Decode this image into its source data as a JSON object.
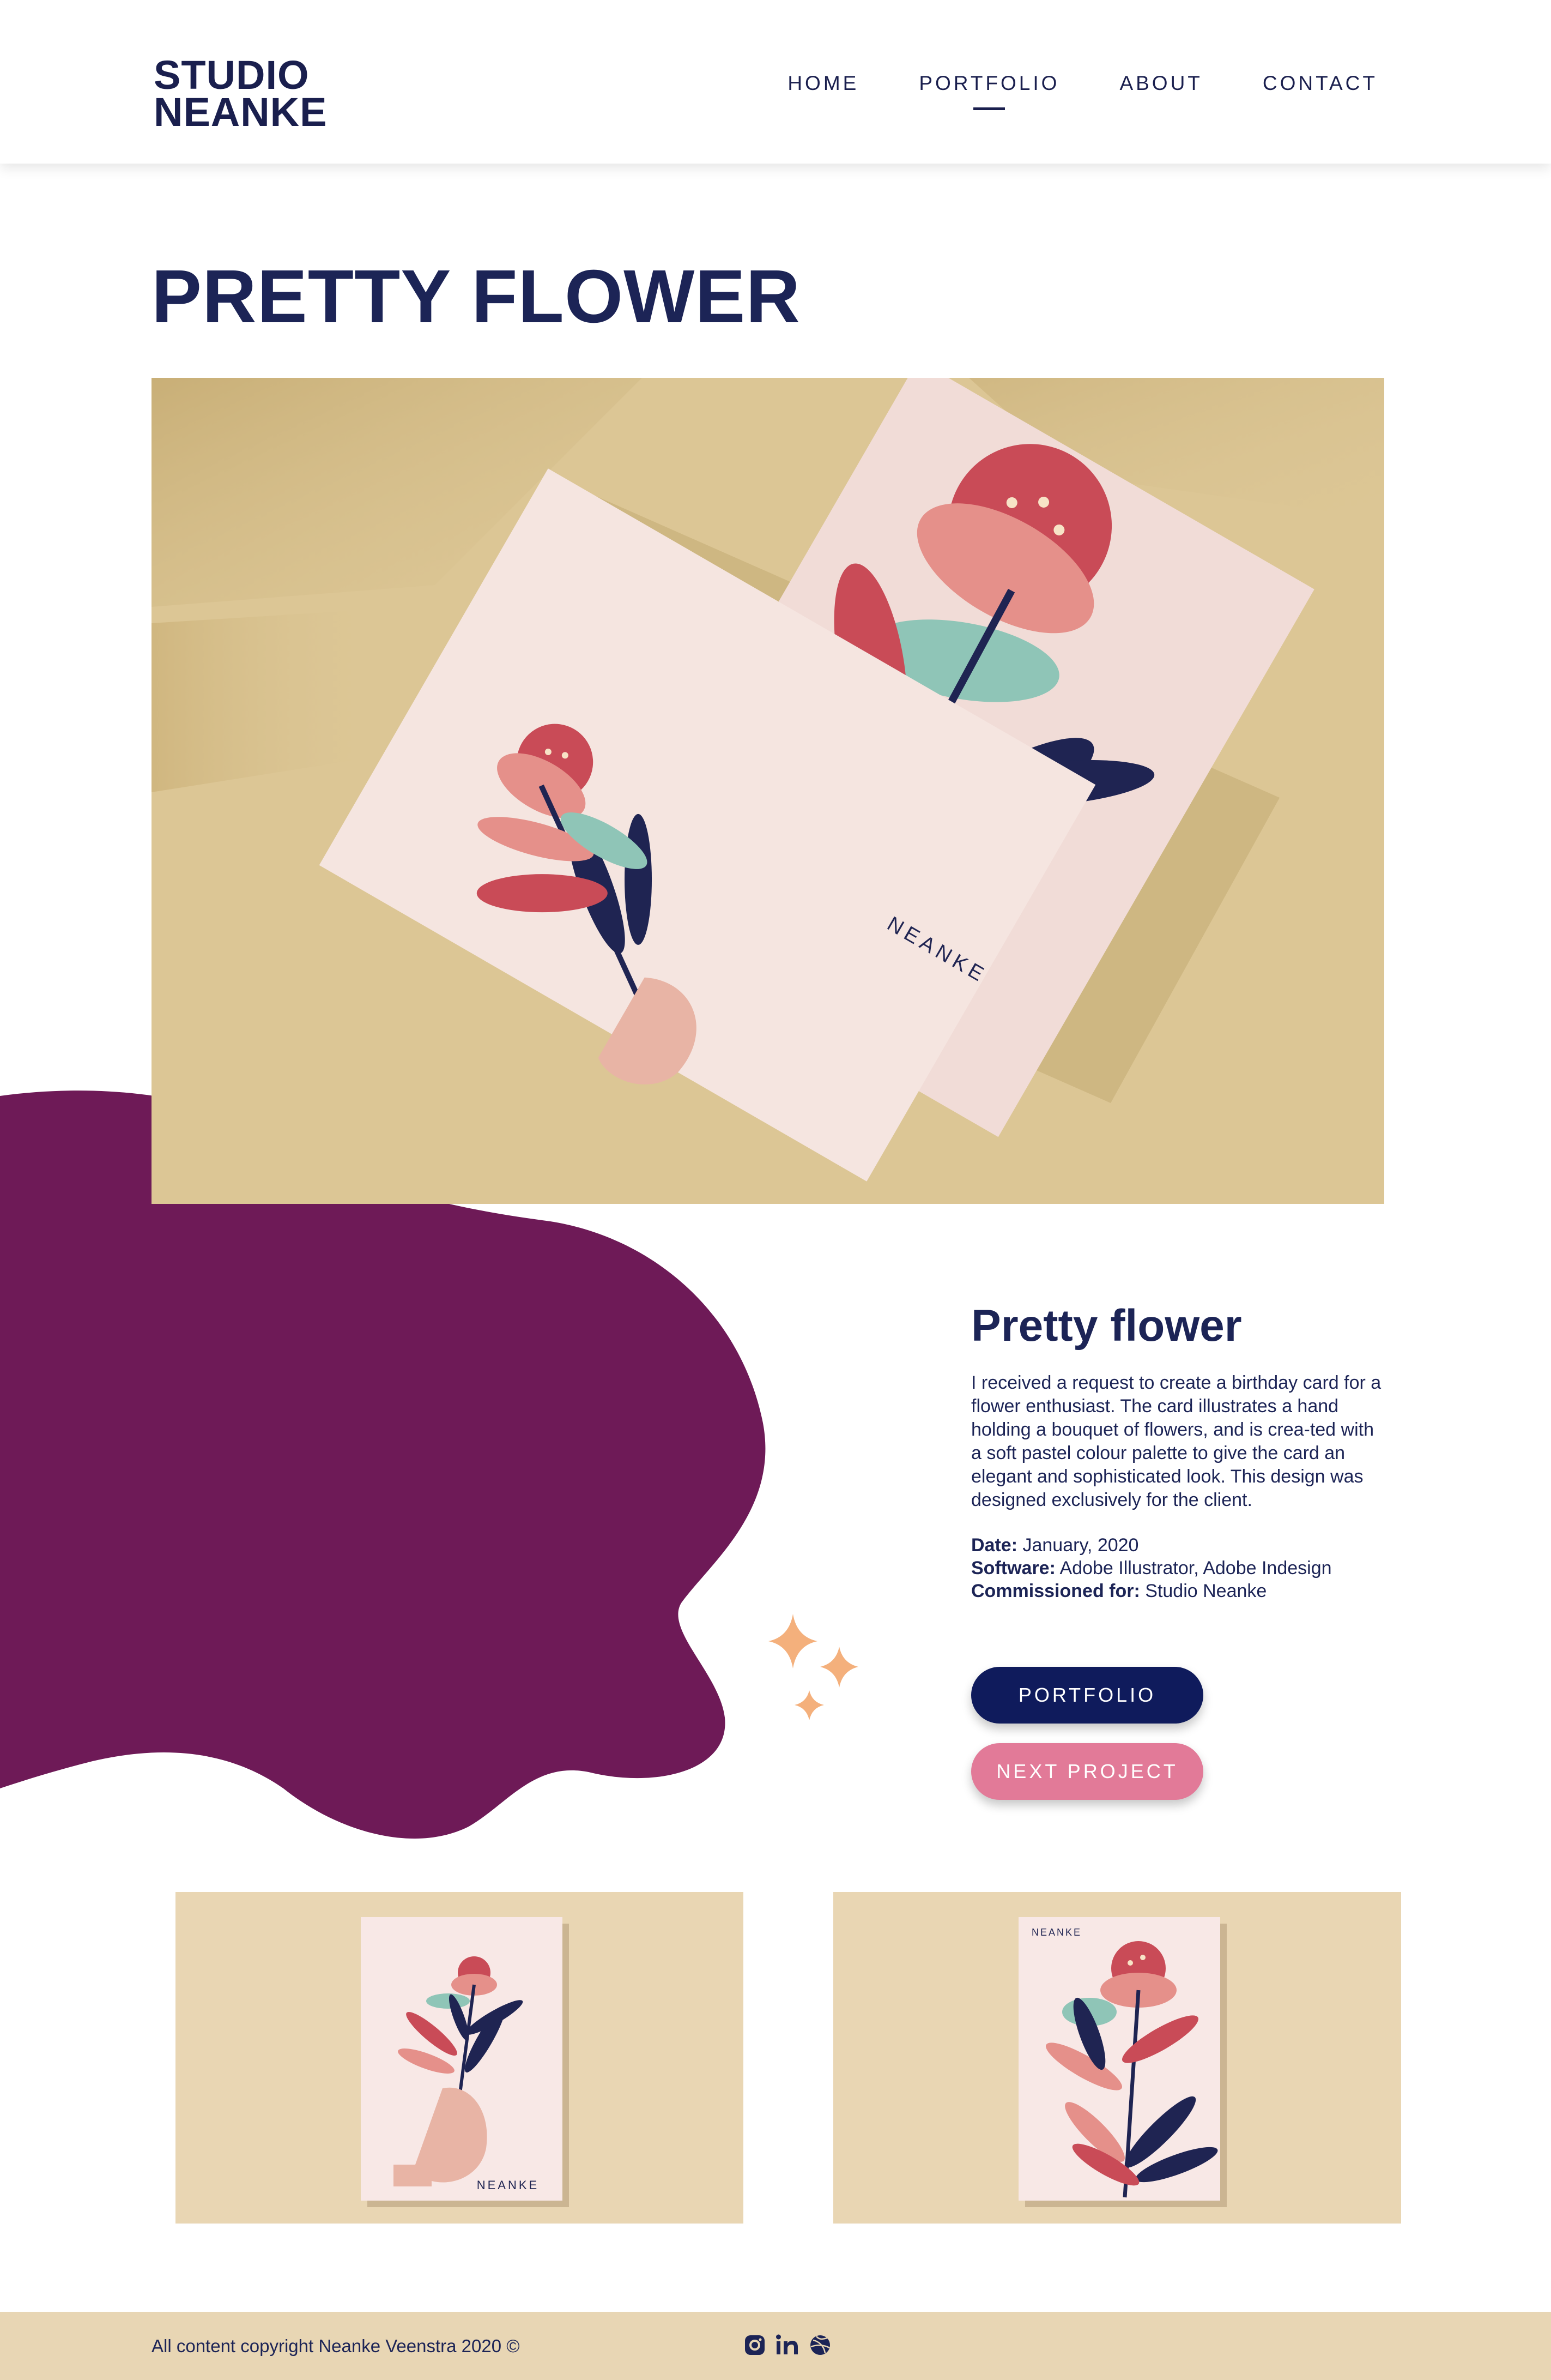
{
  "header": {
    "logo_line1": "STUDIO",
    "logo_line2": "NEANKE",
    "nav": [
      {
        "label": "HOME"
      },
      {
        "label": "PORTFOLIO"
      },
      {
        "label": "ABOUT"
      },
      {
        "label": "CONTACT"
      }
    ],
    "active_nav": "PORTFOLIO"
  },
  "page": {
    "title": "PRETTY FLOWER"
  },
  "hero": {
    "card_signature": "NEANKE"
  },
  "project": {
    "title": "Pretty flower",
    "description": "I received a request to create a birthday card for a flower enthusiast. The card illustrates a hand holding a bouquet of flowers, and is crea-ted with a soft pastel colour palette to give the card an elegant and sophisticated look. This design was designed exclusively for the client.",
    "date_label": "Date:",
    "date_value": "January, 2020",
    "software_label": "Software:",
    "software_value": "Adobe Illustrator, Adobe Indesign",
    "commissioned_label": "Commissioned for:",
    "commissioned_value": "Studio Neanke"
  },
  "buttons": {
    "portfolio": "PORTFOLIO",
    "next_project": "NEXT PROJECT"
  },
  "thumbnails": [
    {
      "signature": "NEANKE"
    },
    {
      "signature": "NEANKE"
    }
  ],
  "footer": {
    "copyright": "All content copyright Neanke Veenstra 2020 ©",
    "social_icons": [
      "instagram-icon",
      "linkedin-icon",
      "dribbble-icon"
    ]
  },
  "colors": {
    "navy": "#1c2456",
    "plum": "#6e1a57",
    "pink_button": "#e27a98",
    "navy_button": "#0f1b5c",
    "sand": "#e8d6b4",
    "sparkle": "#f4b07c"
  }
}
